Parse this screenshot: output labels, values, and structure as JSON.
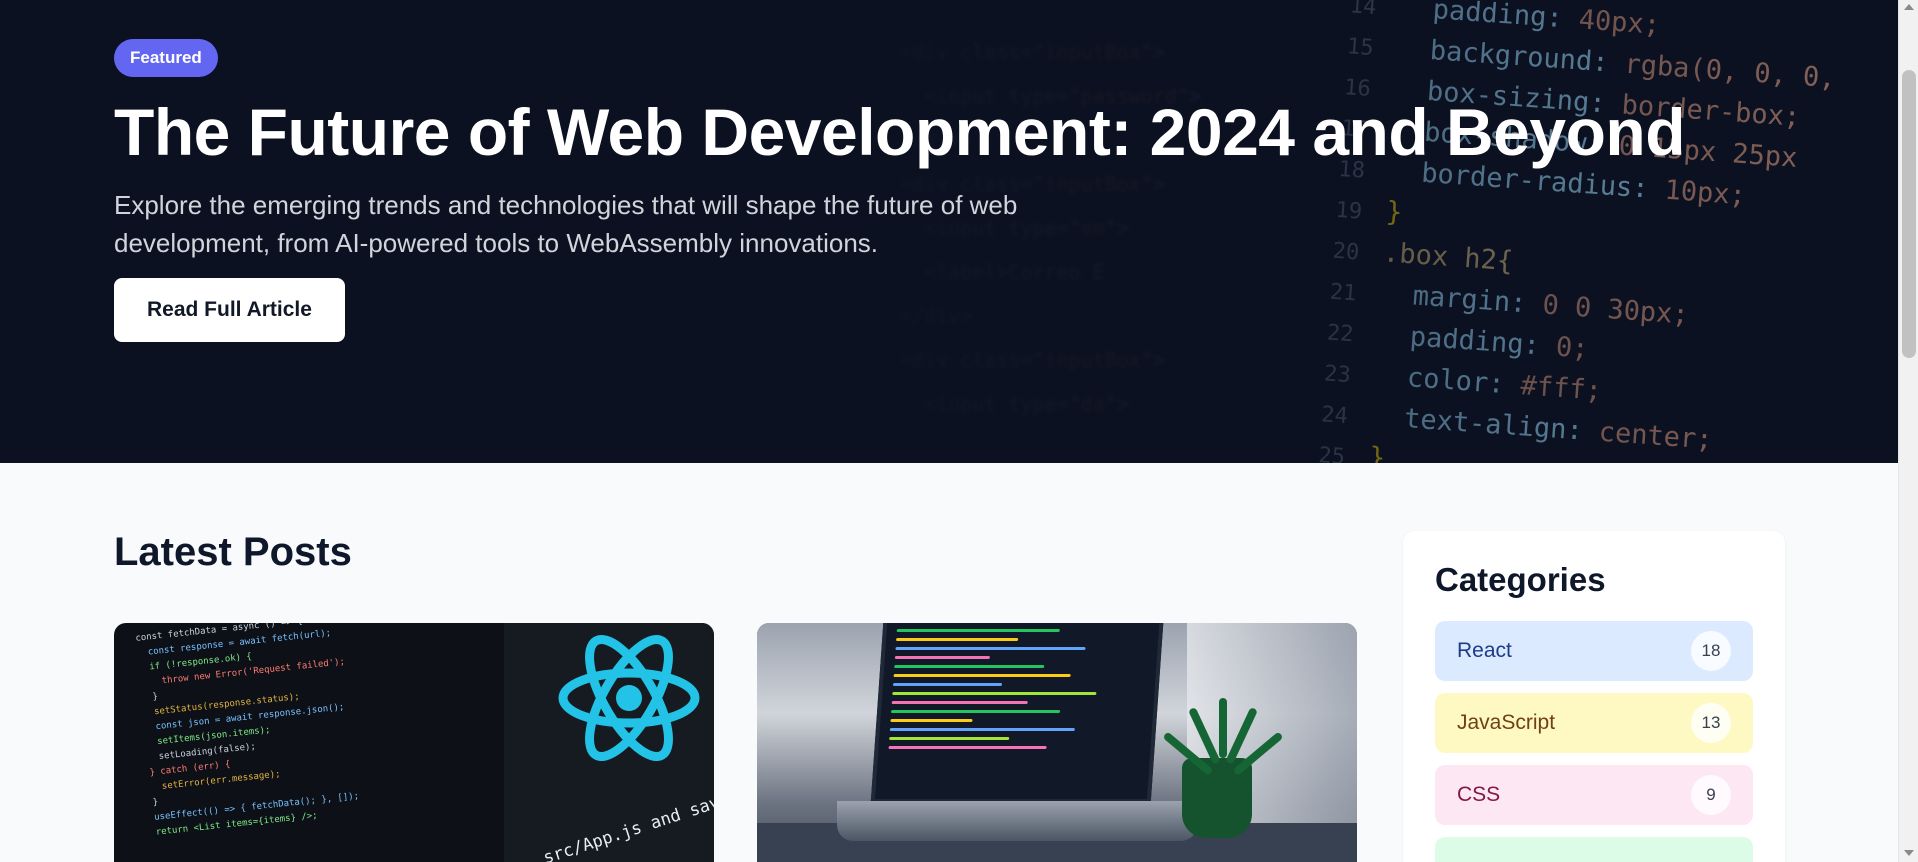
{
  "hero": {
    "badge": "Featured",
    "title": "The Future of Web Development: 2024 and Beyond",
    "subtitle": "Explore the emerging trends and technologies that will shape the future of web development, from AI-powered tools to WebAssembly innovations.",
    "cta_label": "Read Full Article",
    "code_lines": [
      {
        "n": "14",
        "a": "padding",
        "b": "40px;"
      },
      {
        "n": "15",
        "a": "background",
        "b": "rgba(0, 0, 0,"
      },
      {
        "n": "16",
        "a": "box-sizing",
        "b": "border-box;"
      },
      {
        "n": "17",
        "a": "box-shadow",
        "b": "0 15px 25px"
      },
      {
        "n": "18",
        "a": "border-radius",
        "b": "10px;"
      },
      {
        "n": "19",
        "a": "}",
        "b": ""
      },
      {
        "n": "20",
        "a": ".box h2{",
        "b": ""
      },
      {
        "n": "21",
        "a": "margin",
        "b": "0 0 30px;"
      },
      {
        "n": "22",
        "a": "padding",
        "b": "0;"
      },
      {
        "n": "23",
        "a": "color",
        "b": "#fff;"
      },
      {
        "n": "24",
        "a": "text-align",
        "b": "center;"
      },
      {
        "n": "25",
        "a": "}",
        "b": ""
      },
      {
        "n": "26",
        "a": "",
        "b": ""
      }
    ]
  },
  "main": {
    "section_title": "Latest Posts",
    "card1_path": "src/App.js and save to rel"
  },
  "sidebar": {
    "title": "Categories",
    "categories": [
      {
        "label": "React",
        "count": "18",
        "bg": "#dbeafe",
        "color": "#1e3a8a"
      },
      {
        "label": "JavaScript",
        "count": "13",
        "bg": "#fef9c3",
        "color": "#713f12"
      },
      {
        "label": "CSS",
        "count": "9",
        "bg": "#fce7f3",
        "color": "#831843"
      },
      {
        "label": "",
        "count": "",
        "bg": "#dcfce7",
        "color": "#14532d"
      }
    ]
  },
  "colors": {
    "accent": "#6366f1",
    "hero_bg": "#0b1120",
    "page_bg": "#f8fafc"
  }
}
